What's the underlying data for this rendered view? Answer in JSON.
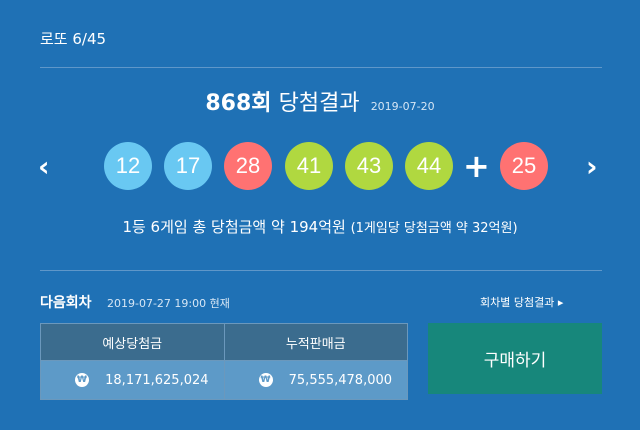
{
  "header": {
    "title": "로또 6/45"
  },
  "draw": {
    "round_number": "868회",
    "round_suffix": "당첨결과",
    "date": "2019-07-20",
    "numbers": [
      "12",
      "17",
      "28",
      "41",
      "43",
      "44"
    ],
    "number_colors": [
      "blue",
      "blue",
      "red",
      "green",
      "green",
      "green"
    ],
    "plus_symbol": "+",
    "bonus": "25",
    "bonus_color": "red"
  },
  "nav": {
    "prev_label": "‹",
    "next_label": "›"
  },
  "prize": {
    "main": "1등 6게임 총 당첨금액 약 194억원",
    "detail": "(1게임당 당첨금액 약 32억원)"
  },
  "next_draw": {
    "label": "다음회차",
    "info": "2019-07-27 19:00 현재",
    "history_link": "회차별 당첨결과 ▸"
  },
  "stats": {
    "headers": [
      "예상당첨금",
      "누적판매금"
    ],
    "currency_icon": "₩",
    "values": [
      "18,171,625,024",
      "75,555,478,000"
    ]
  },
  "buy_button": {
    "label": "구매하기"
  }
}
